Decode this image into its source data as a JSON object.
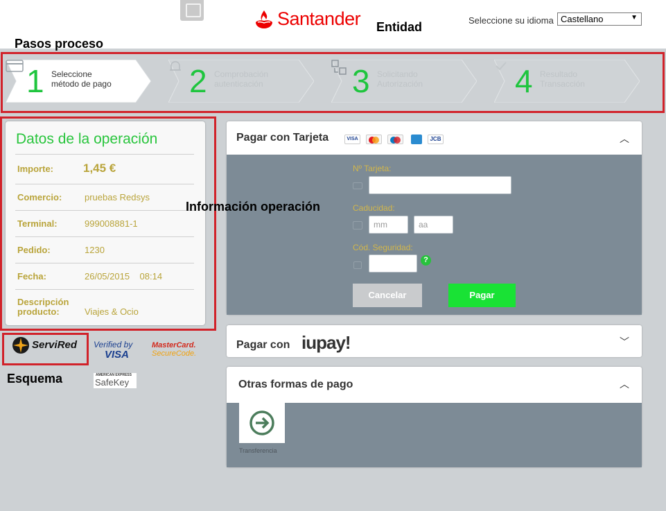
{
  "header": {
    "brand": "Santander",
    "language_label": "Seleccione su idioma",
    "language_value": "Castellano",
    "colors": {
      "brand": "#ec0000",
      "accent": "#1fc53e"
    }
  },
  "annotations": {
    "entidad": "Entidad",
    "pasos": "Pasos proceso",
    "informacion": "Información operación",
    "esquema": "Esquema"
  },
  "steps": [
    {
      "number": "1",
      "label1": "Seleccione",
      "label2": "método de pago",
      "icon": "card-icon",
      "active": true
    },
    {
      "number": "2",
      "label1": "Comprobación",
      "label2": "autenticación",
      "icon": "bell-icon",
      "active": false
    },
    {
      "number": "3",
      "label1": "Solicitando",
      "label2": "Autorización",
      "icon": "transfer-icon",
      "active": false
    },
    {
      "number": "4",
      "label1": "Resultado",
      "label2": "Transacción",
      "icon": "check-icon",
      "active": false
    }
  ],
  "operation": {
    "title": "Datos de la operación",
    "rows": [
      {
        "label": "Importe:",
        "value": "1,45  €"
      },
      {
        "label": "Comercio:",
        "value": "pruebas Redsys"
      },
      {
        "label": "Terminal:",
        "value": "999008881-1"
      },
      {
        "label": "Pedido:",
        "value": "1230"
      },
      {
        "label": "Fecha:",
        "value": "26/05/2015    08:14"
      },
      {
        "label": "Descripción",
        "label2": "producto:",
        "value": "Viajes & Ocio"
      }
    ]
  },
  "security_logos": {
    "servired": "ServiRed",
    "verified_by": "Verified by",
    "visa": "VISA",
    "mastercard": "MasterCard.",
    "securecode": "SecureCode.",
    "amex_top": "AMERICAN EXPRESS",
    "safekey": "SafeKey"
  },
  "card_payment": {
    "title": "Pagar con Tarjeta",
    "brands": [
      "VISA",
      "MC",
      "Maestro",
      "AMEX",
      "JCB"
    ],
    "card_number_label": "Nº Tarjeta:",
    "expiry_label": "Caducidad:",
    "month_placeholder": "mm",
    "year_placeholder": "aa",
    "cvv_label": "Cód. Seguridad:",
    "help": "?",
    "cancel_label": "Cancelar",
    "pay_label": "Pagar"
  },
  "iupay": {
    "title": "Pagar con",
    "logo": "iupay!"
  },
  "other_methods": {
    "title": "Otras formas de pago",
    "transfer_label": "Transferencia"
  }
}
